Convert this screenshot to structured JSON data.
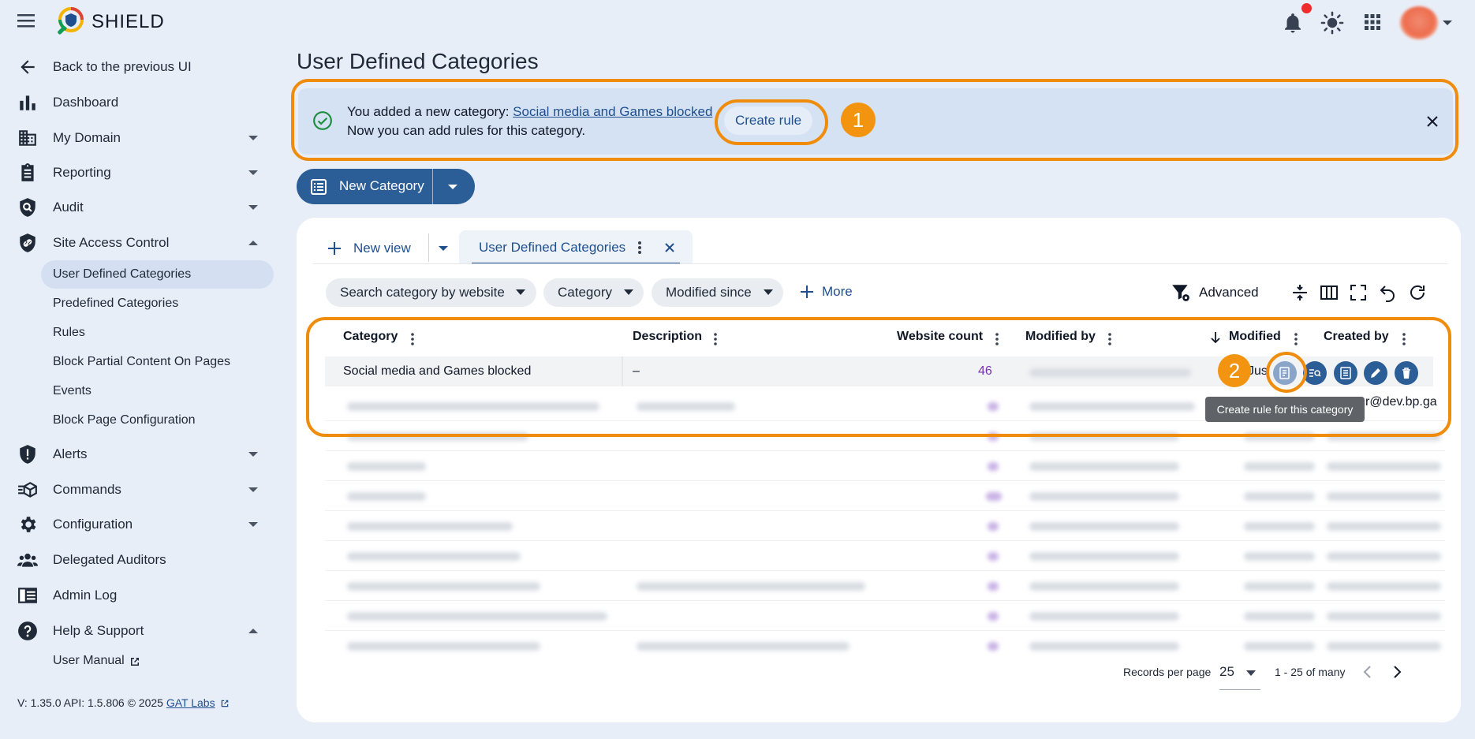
{
  "app": {
    "name": "SHIELD"
  },
  "sidebar": {
    "back": "Back to the previous UI",
    "items": [
      {
        "label": "Dashboard",
        "icon": "bar-chart-icon"
      },
      {
        "label": "My Domain",
        "icon": "building-icon"
      },
      {
        "label": "Reporting",
        "icon": "clipboard-icon"
      },
      {
        "label": "Audit",
        "icon": "audit-search-icon"
      },
      {
        "label": "Site Access Control",
        "icon": "shield-link-icon"
      },
      {
        "label": "Alerts",
        "icon": "shield-alert-icon"
      },
      {
        "label": "Commands",
        "icon": "commands-icon"
      },
      {
        "label": "Configuration",
        "icon": "gear-icon"
      },
      {
        "label": "Delegated Auditors",
        "icon": "people-icon"
      },
      {
        "label": "Admin Log",
        "icon": "log-icon"
      },
      {
        "label": "Help & Support",
        "icon": "help-icon"
      }
    ],
    "site_access_children": [
      "User Defined Categories",
      "Predefined Categories",
      "Rules",
      "Block Partial Content On Pages",
      "Events",
      "Block Page Configuration"
    ],
    "help_children": [
      "User Manual"
    ],
    "footer": {
      "version": "V: 1.35.0  API: 1.5.806  © 2025 ",
      "company": "GAT Labs"
    }
  },
  "page": {
    "title": "User Defined Categories",
    "banner": {
      "prefix": "You added a new category: ",
      "category_link": "Social media and Games blocked",
      "line2": "Now you can add rules for this category.",
      "button": "Create rule"
    },
    "new_category_button": "New Category",
    "annotations": [
      "1",
      "2"
    ]
  },
  "tabs": {
    "new_view": "New view",
    "active": "User Defined Categories"
  },
  "filters": {
    "chips": [
      "Search category by website",
      "Category",
      "Modified since"
    ],
    "more": "More",
    "advanced": "Advanced"
  },
  "table": {
    "columns": [
      "Category",
      "Description",
      "Website count",
      "Modified by",
      "Modified",
      "Created by"
    ],
    "row1": {
      "category": "Social media and Games blocked",
      "description": "–",
      "website_count": "46",
      "modified_partial": "Jus",
      "created_by_partial": "r@dev.bp.ga"
    },
    "tooltip": "Create rule for this category"
  },
  "pagination": {
    "records_label": "Records per page",
    "per_page": "25",
    "range": "1 - 25 of many"
  },
  "colors": {
    "accent": "#2b5d97",
    "annotation": "#f08c0c",
    "banner": "#d5e2f3"
  }
}
